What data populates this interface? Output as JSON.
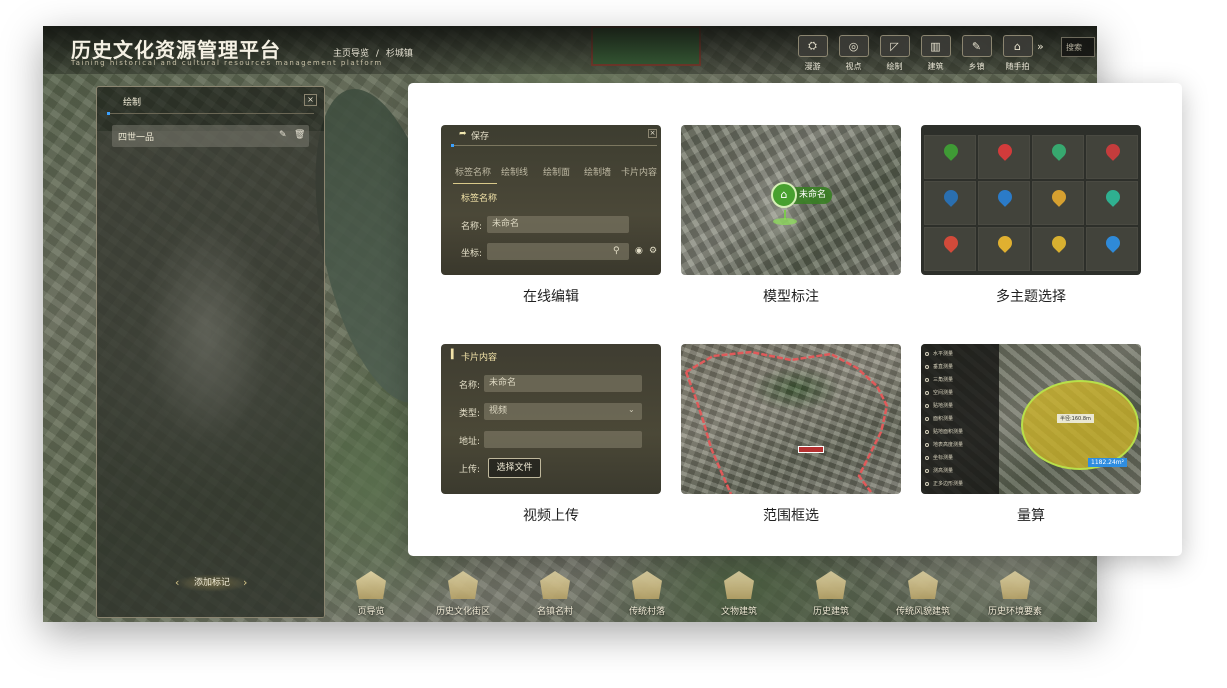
{
  "app": {
    "title": "历史文化资源管理平台",
    "subtitle": "Taining historical and cultural resources management platform",
    "breadcrumb": [
      "主页导览",
      "/",
      "杉城镇"
    ],
    "search_placeholder": "搜索"
  },
  "toolbar": {
    "items": [
      {
        "label": "漫游",
        "icon": "roam-icon"
      },
      {
        "label": "视点",
        "icon": "viewpoint-icon"
      },
      {
        "label": "绘制",
        "icon": "draw-icon"
      },
      {
        "label": "建筑",
        "icon": "building-icon"
      },
      {
        "label": "乡镇",
        "icon": "town-icon"
      },
      {
        "label": "随手拍",
        "icon": "camera-icon"
      }
    ],
    "more": "»"
  },
  "draw_panel": {
    "title": "绘制",
    "close": "×",
    "item_label": "四世一品",
    "edit_icon": "✎",
    "delete_icon": "🗑",
    "add_button": "添加标记",
    "arrow_left": "‹",
    "arrow_right": "›"
  },
  "categories": [
    "页导览",
    "历史文化街区",
    "名镇名村",
    "传统村落",
    "文物建筑",
    "历史建筑",
    "传统风貌建筑",
    "历史环境要素"
  ],
  "features": {
    "online_edit": {
      "label": "在线编辑",
      "title": "保存",
      "tabs": [
        "标签名称",
        "绘制线",
        "绘制面",
        "绘制墙",
        "卡片内容"
      ],
      "section": "标签名称",
      "name_label": "名称:",
      "name_value": "未命名",
      "coord_label": "坐标:",
      "close": "×"
    },
    "model_label": {
      "label": "模型标注",
      "tag": "未命名"
    },
    "multi_theme": {
      "label": "多主题选择",
      "colors": [
        "#3f9a35",
        "#d23b3b",
        "#37a86f",
        "#c43c3c",
        "#2a6fb0",
        "#2b7bc8",
        "#d6a030",
        "#2fb090",
        "#d24a3a",
        "#e0b030",
        "#d8b030",
        "#2f8ad8"
      ]
    },
    "video_upload": {
      "label": "视频上传",
      "title": "卡片内容",
      "name_label": "名称:",
      "name_value": "未命名",
      "type_label": "类型:",
      "type_value": "视频",
      "address_label": "地址:",
      "upload_label": "上传:",
      "choose_file": "选择文件"
    },
    "range_select": {
      "label": "范围框选"
    },
    "measure": {
      "label": "量算",
      "menu": [
        "水平测量",
        "垂直测量",
        "三角测量",
        "空间测量",
        "贴地测量",
        "面积测量",
        "贴地面积测量",
        "地表高度测量",
        "坐标测量",
        "测高测量",
        "正多边形测量"
      ],
      "readout": "半径:160.8m",
      "area": "1182.24m²"
    }
  }
}
